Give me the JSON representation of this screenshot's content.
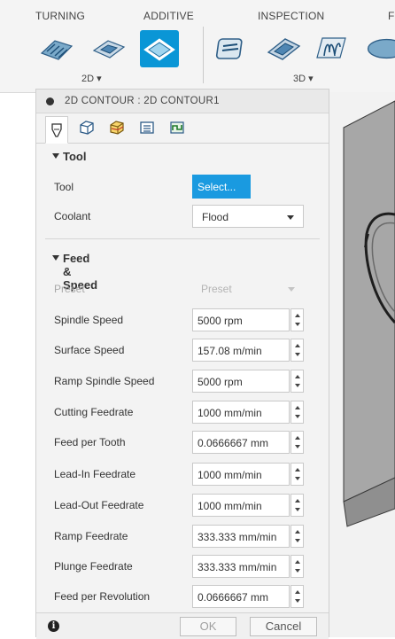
{
  "ribbon": {
    "tabs": [
      {
        "label": "TURNING"
      },
      {
        "label": "ADDITIVE"
      },
      {
        "label": "INSPECTION"
      },
      {
        "label": "F"
      }
    ],
    "group_2d_label": "2D",
    "group_3d_label": "3D"
  },
  "dialog": {
    "title": "2D CONTOUR : 2D CONTOUR1",
    "tool_section": {
      "heading": "Tool",
      "tool_label": "Tool",
      "select_label": "Select...",
      "coolant_label": "Coolant",
      "coolant_value": "Flood"
    },
    "feed_section": {
      "heading": "Feed & Speed",
      "preset_label": "Preset",
      "preset_value": "Preset",
      "rows": [
        {
          "label": "Spindle Speed",
          "value": "5000 rpm"
        },
        {
          "label": "Surface Speed",
          "value": "157.08 m/min"
        },
        {
          "label": "Ramp Spindle Speed",
          "value": "5000 rpm"
        },
        {
          "label": "Cutting Feedrate",
          "value": "1000 mm/min"
        },
        {
          "label": "Feed per Tooth",
          "value": "0.0666667 mm"
        },
        {
          "label": "Lead-In Feedrate",
          "value": "1000 mm/min"
        },
        {
          "label": "Lead-Out Feedrate",
          "value": "1000 mm/min"
        },
        {
          "label": "Ramp Feedrate",
          "value": "333.333 mm/min"
        },
        {
          "label": "Plunge Feedrate",
          "value": "333.333 mm/min"
        },
        {
          "label": "Feed per Revolution",
          "value": "0.0666667 mm"
        }
      ]
    },
    "footer": {
      "info": "i",
      "ok_label": "OK",
      "cancel_label": "Cancel"
    }
  }
}
